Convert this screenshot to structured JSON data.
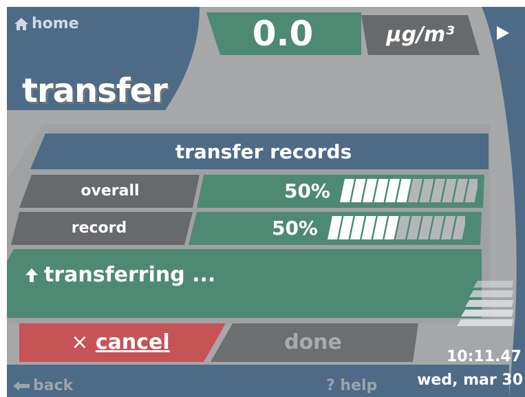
{
  "nav": {
    "home_label": "home",
    "back_label": "back",
    "help_label": "? help"
  },
  "reading": {
    "value": "0.0",
    "unit": "µg/m³"
  },
  "page_title": "transfer",
  "panel": {
    "header": "transfer records",
    "rows": [
      {
        "label": "overall",
        "percent_text": "50%",
        "progress": 0.5
      },
      {
        "label": "record",
        "percent_text": "50%",
        "progress": 0.5
      }
    ]
  },
  "status": {
    "text": "transferring ...",
    "icon": "upload-arrow-icon"
  },
  "buttons": {
    "cancel_prefix": "×",
    "cancel_label": "cancel",
    "done_label": "done"
  },
  "clock": {
    "time": "10:11.47",
    "date": "wed, mar 30"
  },
  "colors": {
    "background_blue": "#4d6b86",
    "frame_gray": "#a5a7a9",
    "accent_green": "#4e8974",
    "label_gray": "#67696c",
    "cancel_red": "#c65356",
    "done_gray": "#6c6e70",
    "bar_white": "#ffffff",
    "bar_gray": "#b4b7b8"
  }
}
